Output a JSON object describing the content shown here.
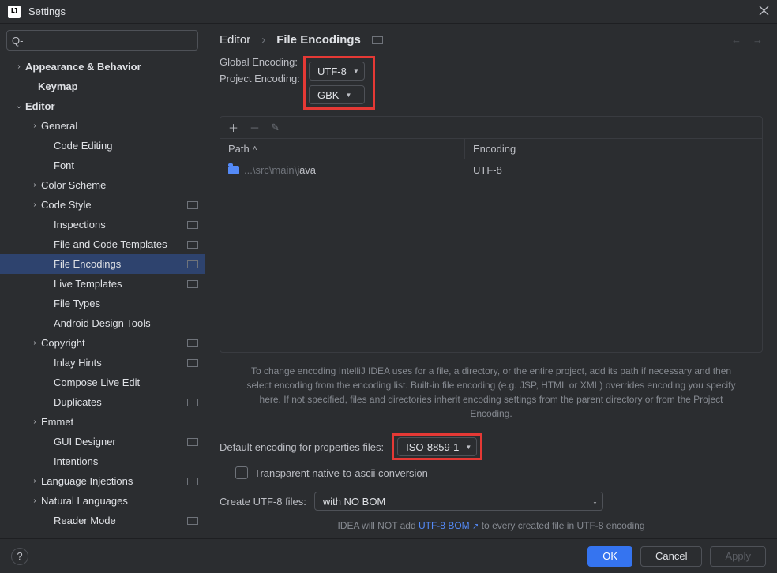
{
  "window": {
    "title": "Settings"
  },
  "search": {
    "placeholder": "",
    "prefix": "Q-"
  },
  "tree": [
    {
      "label": "Appearance & Behavior",
      "indent": 16,
      "chev": "›",
      "bold": true
    },
    {
      "label": "Keymap",
      "indent": 32,
      "chev": "",
      "bold": true
    },
    {
      "label": "Editor",
      "indent": 16,
      "chev": "⌄",
      "bold": true
    },
    {
      "label": "General",
      "indent": 36,
      "chev": "›"
    },
    {
      "label": "Code Editing",
      "indent": 52,
      "chev": ""
    },
    {
      "label": "Font",
      "indent": 52,
      "chev": ""
    },
    {
      "label": "Color Scheme",
      "indent": 36,
      "chev": "›"
    },
    {
      "label": "Code Style",
      "indent": 36,
      "chev": "›",
      "mark": true
    },
    {
      "label": "Inspections",
      "indent": 52,
      "chev": "",
      "mark": true
    },
    {
      "label": "File and Code Templates",
      "indent": 52,
      "chev": "",
      "mark": true
    },
    {
      "label": "File Encodings",
      "indent": 52,
      "chev": "",
      "mark": true,
      "selected": true
    },
    {
      "label": "Live Templates",
      "indent": 52,
      "chev": "",
      "mark": true
    },
    {
      "label": "File Types",
      "indent": 52,
      "chev": ""
    },
    {
      "label": "Android Design Tools",
      "indent": 52,
      "chev": ""
    },
    {
      "label": "Copyright",
      "indent": 36,
      "chev": "›",
      "mark": true
    },
    {
      "label": "Inlay Hints",
      "indent": 52,
      "chev": "",
      "mark": true
    },
    {
      "label": "Compose Live Edit",
      "indent": 52,
      "chev": ""
    },
    {
      "label": "Duplicates",
      "indent": 52,
      "chev": "",
      "mark": true
    },
    {
      "label": "Emmet",
      "indent": 36,
      "chev": "›"
    },
    {
      "label": "GUI Designer",
      "indent": 52,
      "chev": "",
      "mark": true
    },
    {
      "label": "Intentions",
      "indent": 52,
      "chev": ""
    },
    {
      "label": "Language Injections",
      "indent": 36,
      "chev": "›",
      "mark": true
    },
    {
      "label": "Natural Languages",
      "indent": 36,
      "chev": "›"
    },
    {
      "label": "Reader Mode",
      "indent": 52,
      "chev": "",
      "mark": true
    }
  ],
  "breadcrumb": {
    "parent": "Editor",
    "current": "File Encodings"
  },
  "globalEncoding": {
    "label": "Global Encoding:",
    "value": "UTF-8"
  },
  "projectEncoding": {
    "label": "Project Encoding:",
    "value": "GBK"
  },
  "table": {
    "col1": "Path",
    "col2": "Encoding",
    "rows": [
      {
        "pathPrefix": "...\\src\\main\\",
        "pathName": "java",
        "encoding": "UTF-8"
      }
    ]
  },
  "hint": "To change encoding IntelliJ IDEA uses for a file, a directory, or the entire project, add its path if necessary and then select encoding from the encoding list. Built-in file encoding (e.g. JSP, HTML or XML) overrides encoding you specify here. If not specified, files and directories inherit encoding settings from the parent directory or from the Project Encoding.",
  "propsEncoding": {
    "label": "Default encoding for properties files:",
    "value": "ISO-8859-1"
  },
  "transparent": {
    "label": "Transparent native-to-ascii conversion"
  },
  "createUtf8": {
    "label": "Create UTF-8 files:",
    "value": "with NO BOM"
  },
  "bomNote": {
    "pre": "IDEA will NOT add ",
    "link": "UTF-8 BOM",
    "post": " to every created file in UTF-8 encoding"
  },
  "buttons": {
    "ok": "OK",
    "cancel": "Cancel",
    "apply": "Apply"
  }
}
